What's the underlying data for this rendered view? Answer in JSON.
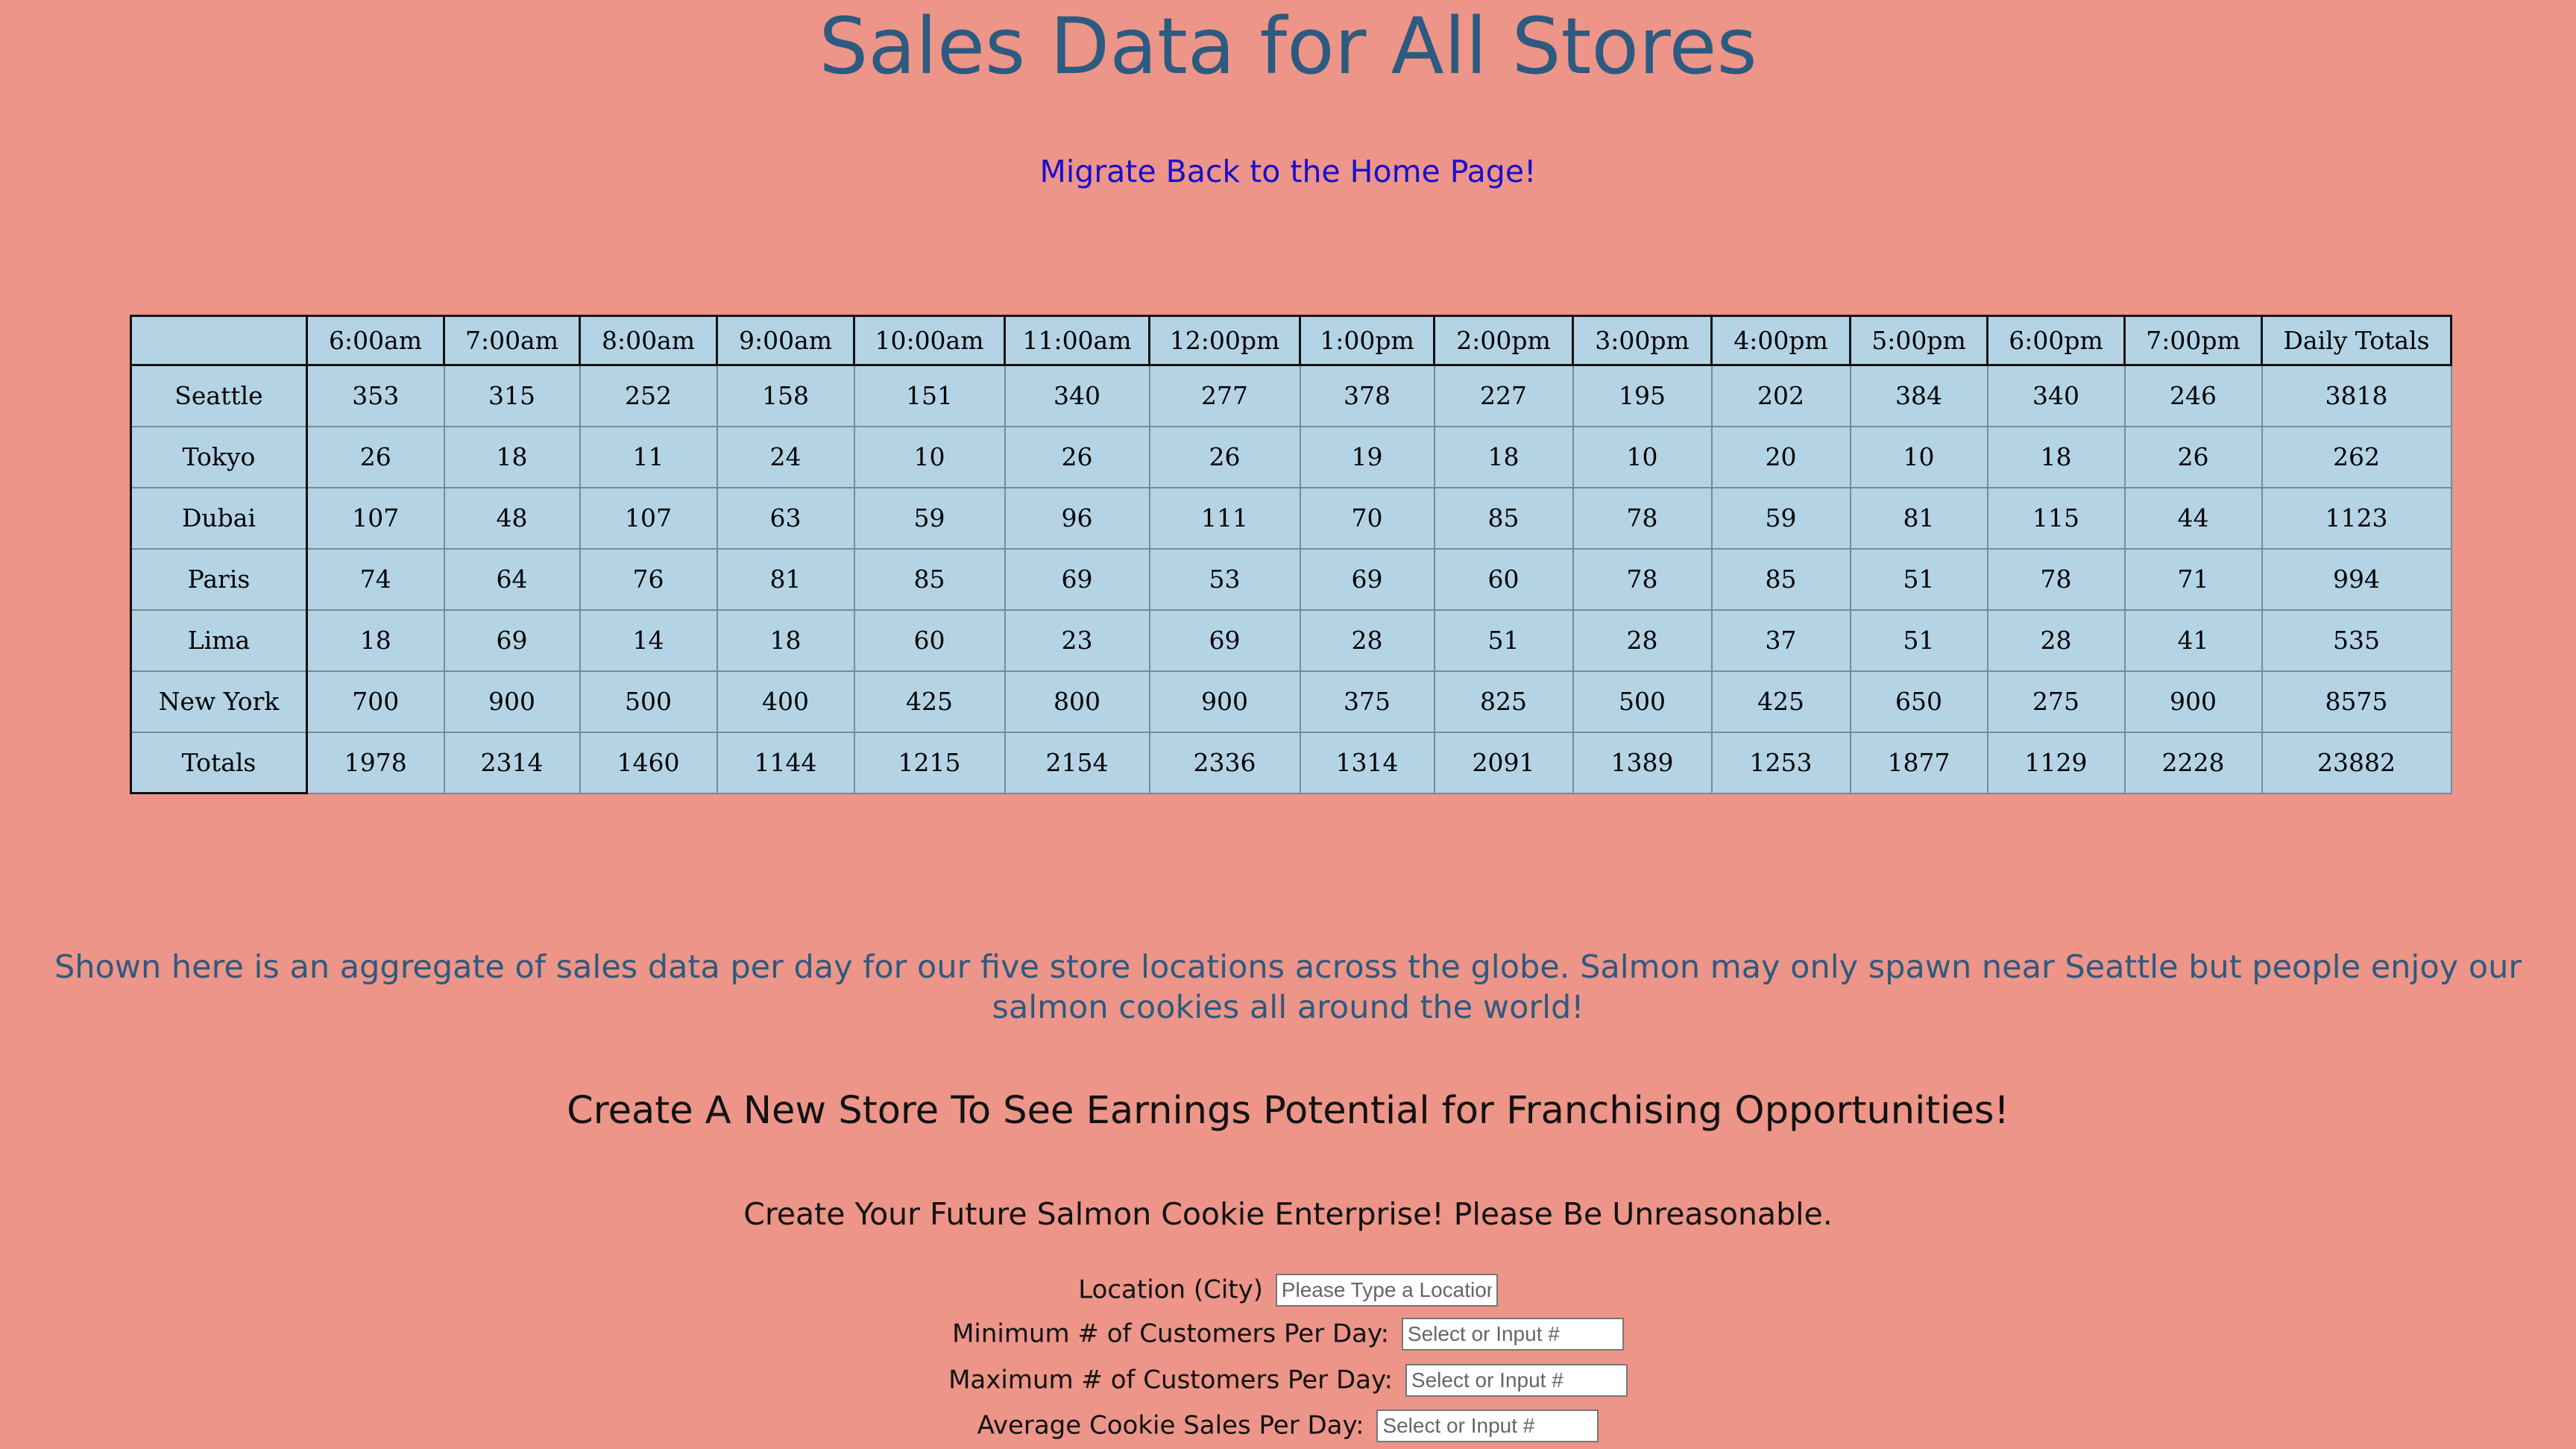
{
  "page": {
    "title": "Sales Data for All Stores",
    "home_link": "Migrate Back to the Home Page!",
    "description": "Shown here is an aggregate of sales data per day for our five store locations across the globe. Salmon may only spawn near Seattle but people enjoy our salmon cookies all around the world!",
    "create_heading": "Create A New Store To See Earnings Potential for Franchising Opportunities!",
    "create_subheading": "Create Your Future Salmon Cookie Enterprise! Please Be Unreasonable."
  },
  "table": {
    "corner": "",
    "hours": [
      "6:00am",
      "7:00am",
      "8:00am",
      "9:00am",
      "10:00am",
      "11:00am",
      "12:00pm",
      "1:00pm",
      "2:00pm",
      "3:00pm",
      "4:00pm",
      "5:00pm",
      "6:00pm",
      "7:00pm"
    ],
    "totals_header": "Daily Totals",
    "rows": [
      {
        "store": "Seattle",
        "values": [
          "353",
          "315",
          "252",
          "158",
          "151",
          "340",
          "277",
          "378",
          "227",
          "195",
          "202",
          "384",
          "340",
          "246"
        ],
        "total": "3818"
      },
      {
        "store": "Tokyo",
        "values": [
          "26",
          "18",
          "11",
          "24",
          "10",
          "26",
          "26",
          "19",
          "18",
          "10",
          "20",
          "10",
          "18",
          "26"
        ],
        "total": "262"
      },
      {
        "store": "Dubai",
        "values": [
          "107",
          "48",
          "107",
          "63",
          "59",
          "96",
          "111",
          "70",
          "85",
          "78",
          "59",
          "81",
          "115",
          "44"
        ],
        "total": "1123"
      },
      {
        "store": "Paris",
        "values": [
          "74",
          "64",
          "76",
          "81",
          "85",
          "69",
          "53",
          "69",
          "60",
          "78",
          "85",
          "51",
          "78",
          "71"
        ],
        "total": "994"
      },
      {
        "store": "Lima",
        "values": [
          "18",
          "69",
          "14",
          "18",
          "60",
          "23",
          "69",
          "28",
          "51",
          "28",
          "37",
          "51",
          "28",
          "41"
        ],
        "total": "535"
      },
      {
        "store": "New York",
        "values": [
          "700",
          "900",
          "500",
          "400",
          "425",
          "800",
          "900",
          "375",
          "825",
          "500",
          "425",
          "650",
          "275",
          "900"
        ],
        "total": "8575"
      }
    ],
    "footer": {
      "label": "Totals",
      "values": [
        "1978",
        "2314",
        "1460",
        "1144",
        "1215",
        "2154",
        "2336",
        "1314",
        "2091",
        "1389",
        "1253",
        "1877",
        "1129",
        "2228"
      ],
      "total": "23882"
    }
  },
  "form": {
    "location": {
      "label": "Location (City)",
      "placeholder": "Please Type a Location",
      "value": ""
    },
    "min_customers": {
      "label": "Minimum # of Customers Per Day:",
      "placeholder": "Select or Input #",
      "value": ""
    },
    "max_customers": {
      "label": "Maximum # of Customers Per Day:",
      "placeholder": "Select or Input #",
      "value": ""
    },
    "avg_sales": {
      "label": "Average Cookie Sales Per Day:",
      "placeholder": "Select or Input #",
      "value": ""
    }
  },
  "colors": {
    "background": "#ec9588",
    "title": "#2d5a80",
    "link": "#1a0dcc",
    "table_cell": "#b4d4e6"
  }
}
